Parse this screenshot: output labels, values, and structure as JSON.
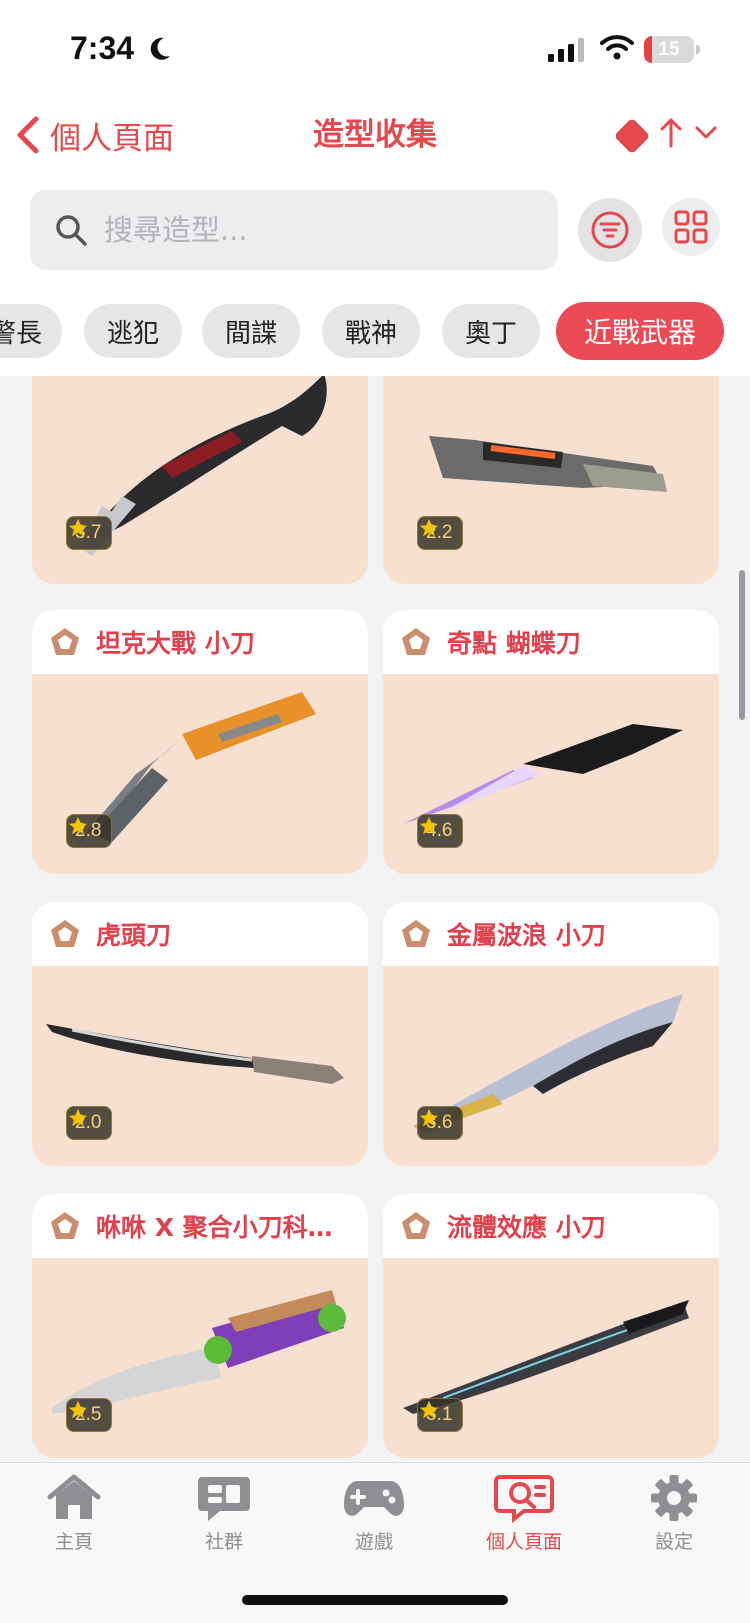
{
  "status_bar": {
    "time": "7:34",
    "battery": "15"
  },
  "nav": {
    "back_label": "個人頁面",
    "title": "造型收集"
  },
  "search": {
    "placeholder": "搜尋造型..."
  },
  "chips": [
    {
      "label": "警長",
      "active": false
    },
    {
      "label": "逃犯",
      "active": false
    },
    {
      "label": "間諜",
      "active": false
    },
    {
      "label": "戰神",
      "active": false
    },
    {
      "label": "奧丁",
      "active": false
    },
    {
      "label": "近戰武器",
      "active": true
    }
  ],
  "cards": [
    {
      "name": "",
      "rating": "3.7"
    },
    {
      "name": "",
      "rating": "2.2"
    },
    {
      "name": "坦克大戰 小刀",
      "rating": "2.8"
    },
    {
      "name": "奇點 蝴蝶刀",
      "rating": "4.6"
    },
    {
      "name": "虎頭刀",
      "rating": "2.0"
    },
    {
      "name": "金屬波浪 小刀",
      "rating": "3.6"
    },
    {
      "name": "咻咻 X 聚合小刀科…",
      "rating": "2.5"
    },
    {
      "name": "流體效應 小刀",
      "rating": "3.1"
    }
  ],
  "tabs": [
    {
      "label": "主頁",
      "icon": "home-icon",
      "active": false
    },
    {
      "label": "社群",
      "icon": "chat-icon",
      "active": false
    },
    {
      "label": "遊戲",
      "icon": "gamepad-icon",
      "active": false
    },
    {
      "label": "個人頁面",
      "icon": "profile-search-icon",
      "active": true
    },
    {
      "label": "設定",
      "icon": "gear-icon",
      "active": false
    }
  ],
  "colors": {
    "accent": "#e5484d",
    "card_bg": "#f7e0d0",
    "chip_active": "#ec4a55"
  }
}
